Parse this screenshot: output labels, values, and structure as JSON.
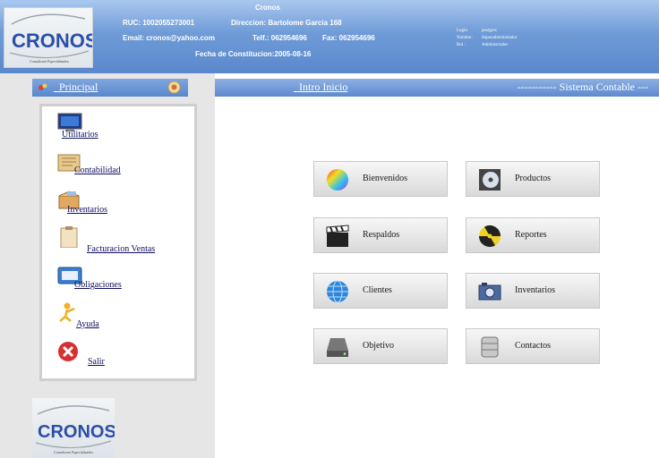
{
  "header": {
    "company_name": "Cronos",
    "ruc": "RUC:  1002055273001",
    "direccion": "Direccion: Bartolome Garcia 168",
    "email": "Email: cronos@yahoo.com",
    "telf": "Telf.: 062954696",
    "fax": "Fax: 062954696",
    "fecha": "Fecha de Constitucion:2005-08-16",
    "login_label": "Login",
    "login_value": "postgres",
    "nombre_label": "Nombre:",
    "nombre_value": "Superadministrador",
    "rol_label": "Rol :",
    "rol_value": "Administrador"
  },
  "logo": {
    "text": "CRONOS",
    "tagline": "Consultores Especializados"
  },
  "sidebar": {
    "title": "_Principal",
    "items": [
      {
        "label": "Utilitarios",
        "icon": "monitor-icon"
      },
      {
        "label": "Contabilidad",
        "icon": "ledger-icon"
      },
      {
        "label": "Inventarios",
        "icon": "box-icon"
      },
      {
        "label": "Facturacion Ventas",
        "icon": "clipboard-icon"
      },
      {
        "label": "Obligaciones",
        "icon": "tray-icon"
      },
      {
        "label": "Ayuda",
        "icon": "help-figure-icon"
      },
      {
        "label": "Salir",
        "icon": "exit-x-icon"
      }
    ]
  },
  "tabs": {
    "intro": "_Intro Inicio",
    "sistema": "----------- Sistema Contable ---"
  },
  "buttons": [
    {
      "label": "Bienvenidos",
      "icon": "color-wheel-icon"
    },
    {
      "label": "Productos",
      "icon": "disc-icon"
    },
    {
      "label": "Respaldos",
      "icon": "clapperboard-icon"
    },
    {
      "label": "Reportes",
      "icon": "radiation-icon"
    },
    {
      "label": "Clientes",
      "icon": "globe-icon"
    },
    {
      "label": "Inventarios",
      "icon": "camera-icon"
    },
    {
      "label": "Objetivo",
      "icon": "drive-icon"
    },
    {
      "label": "Contactos",
      "icon": "database-icon"
    }
  ]
}
